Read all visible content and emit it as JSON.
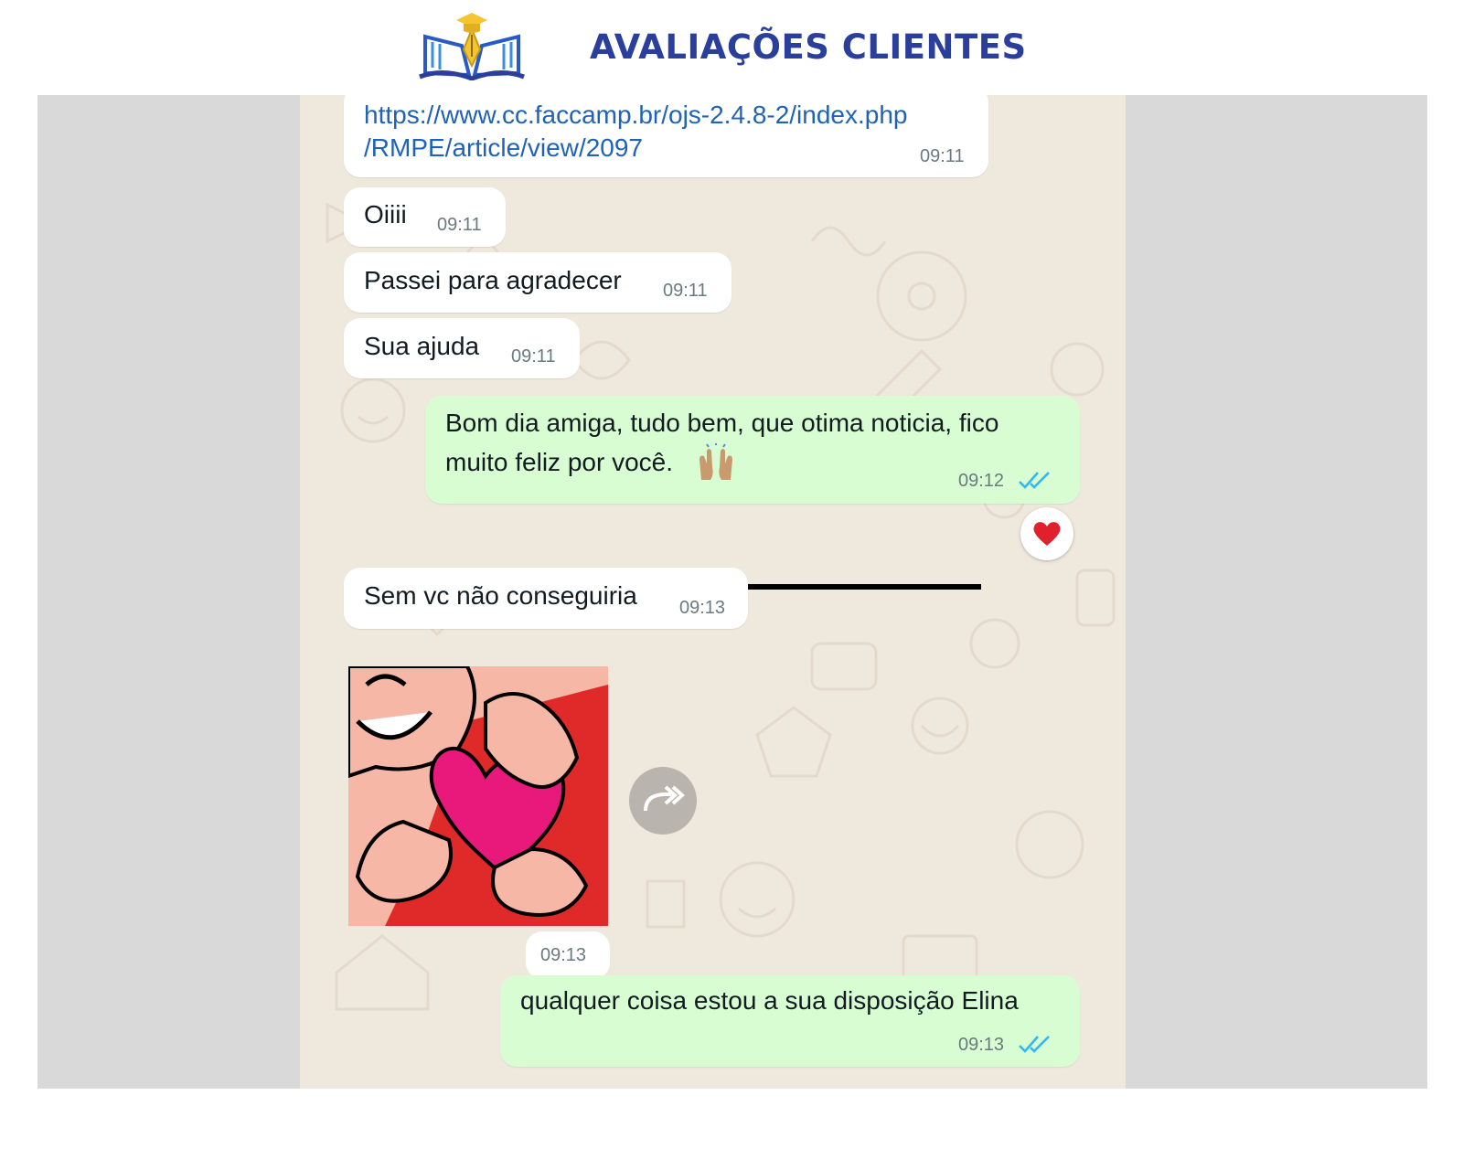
{
  "header": {
    "title": "AVALIAÇÕES CLIENTES",
    "logo_icon": "book-pen-graduation-logo-icon"
  },
  "colors": {
    "incoming": "#ffffff",
    "outgoing": "#d9fdd3",
    "wallpaper": "#efe8dd",
    "link": "#1f62b6",
    "ticks": "#34b7f1"
  },
  "messages": [
    {
      "dir": "in",
      "link_line1": "https://www.cc.faccamp.br/ojs-2.4.8-2/index.php",
      "link_line2": "/RMPE/article/view/2097",
      "time": "09:11"
    },
    {
      "dir": "in",
      "text": "Oiiii",
      "time": "09:11"
    },
    {
      "dir": "in",
      "text": "Passei para agradecer",
      "time": "09:11"
    },
    {
      "dir": "in",
      "text": "Sua ajuda",
      "time": "09:11"
    },
    {
      "dir": "out",
      "line1": "Bom dia amiga, tudo bem, que otima noticia, fico",
      "line2": "muito feliz por você.",
      "emoji": "raising-hands-icon",
      "time": "09:12",
      "status": "read",
      "reaction": "red-heart-icon"
    },
    {
      "dir": "in",
      "text": "Sem vc não conseguiria",
      "time": "09:13"
    },
    {
      "dir": "in",
      "type": "sticker",
      "sticker": "heart-hands-sticker",
      "time": "09:13"
    },
    {
      "dir": "out",
      "text": "qualquer coisa estou a sua disposição Elina",
      "time": "09:13",
      "status": "read"
    }
  ]
}
